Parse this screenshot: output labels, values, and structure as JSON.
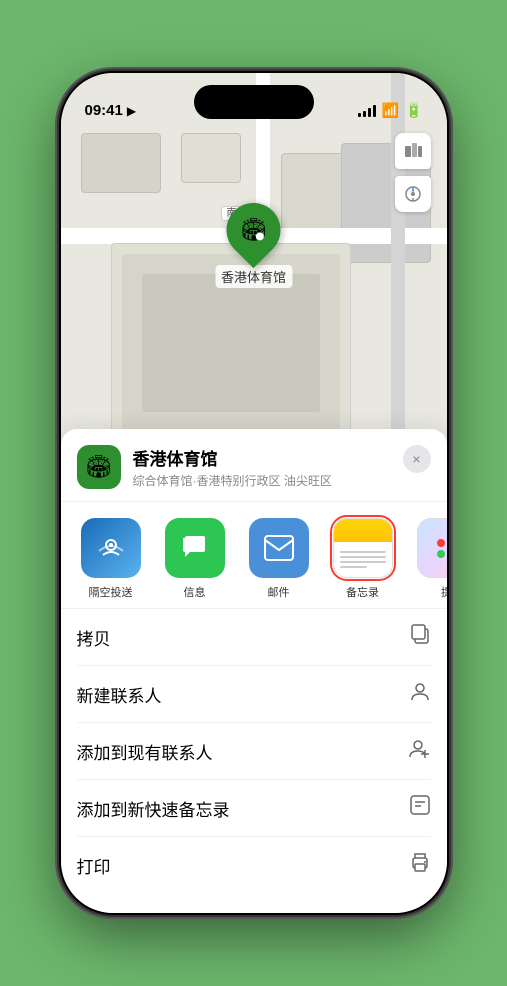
{
  "status_bar": {
    "time": "09:41",
    "location_arrow": "▶"
  },
  "map": {
    "label_south_entrance": "南口",
    "location_name": "香港体育馆",
    "location_subtitle": "综合体育馆·香港特别行政区 油尖旺区"
  },
  "share_row": [
    {
      "id": "airdrop",
      "label": "隔空投送",
      "selected": false
    },
    {
      "id": "messages",
      "label": "信息",
      "selected": false
    },
    {
      "id": "mail",
      "label": "邮件",
      "selected": false
    },
    {
      "id": "notes",
      "label": "备忘录",
      "selected": true
    },
    {
      "id": "more",
      "label": "提",
      "selected": false
    }
  ],
  "actions": [
    {
      "id": "copy",
      "label": "拷贝",
      "icon": "⧉"
    },
    {
      "id": "new-contact",
      "label": "新建联系人",
      "icon": "👤"
    },
    {
      "id": "add-existing",
      "label": "添加到现有联系人",
      "icon": "👤"
    },
    {
      "id": "add-notes",
      "label": "添加到新快速备忘录",
      "icon": "⊡"
    },
    {
      "id": "print",
      "label": "打印",
      "icon": "🖨"
    }
  ],
  "close_label": "×"
}
